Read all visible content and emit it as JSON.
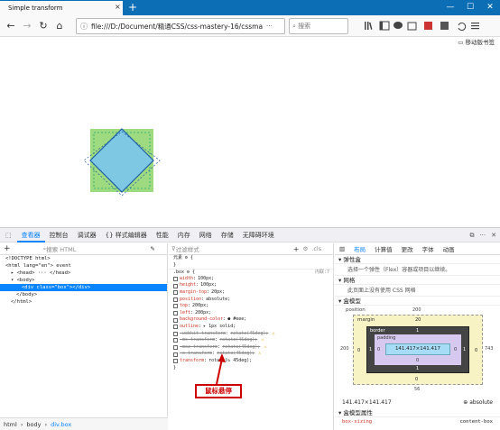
{
  "browser": {
    "tab_title": "Simple transform",
    "tab_close": "×",
    "new_tab": "+",
    "url": "file:///D:/Document/精通CSS/css-mastery-16/cssma",
    "url_more": "···",
    "search_placeholder": "搜索",
    "bookmarks_label": "移动版书签",
    "window_controls": [
      "—",
      "☐",
      "✕"
    ]
  },
  "devtools": {
    "tabs": [
      "查看器",
      "控制台",
      "调试器",
      "{} 样式编辑器",
      "性能",
      "内存",
      "网络",
      "存储",
      "无障碍环境"
    ],
    "active_tab": "查看器",
    "markup_search_placeholder": "搜索 HTML",
    "markup_lines": [
      {
        "text": "<!DOCTYPE html>",
        "indent": 0,
        "selected": false
      },
      {
        "text": "<html lang=\"en\"> event",
        "indent": 0,
        "selected": false
      },
      {
        "text": "▸ <head> ··· </head>",
        "indent": 1,
        "selected": false
      },
      {
        "text": "▾ <body>",
        "indent": 1,
        "selected": false
      },
      {
        "text": "<div class=\"box\"></div>",
        "indent": 3,
        "selected": true
      },
      {
        "text": "</body>",
        "indent": 2,
        "selected": false
      },
      {
        "text": "</html>",
        "indent": 1,
        "selected": false
      }
    ],
    "breadcrumb": [
      "html",
      "body",
      "div.box"
    ],
    "rules_filter_placeholder": "过滤样式",
    "rules_element_label": "元素 ⚙ {",
    "rules_close_brace": "}",
    "rules_selector": ".box ⚙ {",
    "rules_source": "内联:7",
    "cls_label": ".cls",
    "declarations": [
      {
        "prop": "width",
        "val": "100px;",
        "strike": false
      },
      {
        "prop": "height",
        "val": "100px;",
        "strike": false
      },
      {
        "prop": "margin-top",
        "val": "20px;",
        "strike": false
      },
      {
        "prop": "position",
        "val": "absolute;",
        "strike": false
      },
      {
        "prop": "top",
        "val": "200px;",
        "strike": false
      },
      {
        "prop": "left",
        "val": "200px;",
        "strike": false
      },
      {
        "prop": "background-color",
        "val": "● #eee;",
        "strike": false
      },
      {
        "prop": "outline",
        "val": "▸ 1px solid;",
        "strike": false
      },
      {
        "prop": "-webkit-transform",
        "val": "rotate(45deg);",
        "strike": true
      },
      {
        "prop": "-ms-transform",
        "val": "rotate(45deg);",
        "strike": true
      },
      {
        "prop": "-moz-transform",
        "val": "rotate(45deg);",
        "strike": true
      },
      {
        "prop": "-o-transform",
        "val": "rotate(45deg);",
        "strike": true
      },
      {
        "prop": "transform",
        "val": "rotate(↻ 45deg);",
        "strike": false
      }
    ],
    "layout_tabs": [
      "布局",
      "计算值",
      "更改",
      "字体",
      "动画"
    ],
    "active_layout_tab": "布局",
    "flex_section": "弹性盒",
    "flex_note": "选择一个弹性（Flex）容器或项目以继续。",
    "grid_section": "网格",
    "grid_note": "此页面上没有使用 CSS 网格",
    "boxmodel_section": "盒模型",
    "boxmodel": {
      "position_label": "position",
      "position_top": "200",
      "position_left": "200",
      "position_right": "743",
      "position_bottom": "56",
      "margin_label": "margin",
      "margin_top": "20",
      "margin_side": "0",
      "border_label": "border",
      "border_value": "1",
      "padding_label": "padding",
      "padding_value": "0",
      "content": "141.417×141.417"
    },
    "box_size": "141.417×141.417",
    "position_value": "absolute",
    "box_props_section": "盒模型属性",
    "box_sizing_prop": "box-sizing",
    "box_sizing_val": "content-box"
  },
  "annotation": {
    "callout": "鼠标悬停"
  },
  "colors": {
    "tab_bar": "#0c6fb6",
    "accent": "#0a84ff",
    "diamond_fill": "#7ec8e3",
    "diamond_stroke": "#1f5fa8",
    "green_square": "#8dd36a",
    "callout": "#cc0000"
  }
}
